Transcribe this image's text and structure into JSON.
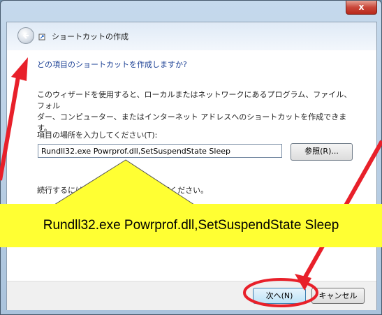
{
  "window": {
    "close_glyph": "x"
  },
  "nav": {
    "title": "ショートカットの作成",
    "back_icon": "back-arrow-icon",
    "wizard_icon": "shortcut-wizard-icon"
  },
  "content": {
    "heading": "どの項目のショートカットを作成しますか?",
    "description": "このウィザードを使用すると、ローカルまたはネットワークにあるプログラム、ファイル、フォル\nダー、コンピューター、またはインターネット アドレスへのショートカットを作成できます。",
    "location_label": "項目の場所を入力してください(T):",
    "location_value": "Rundll32.exe Powrprof.dll,SetSuspendState Sleep",
    "browse_label": "参照(R)...",
    "continue_left": "続行するには",
    "continue_right": "てください。"
  },
  "footer": {
    "next_label": "次へ(N)",
    "cancel_label": "キャンセル"
  },
  "callout": {
    "text": "Rundll32.exe Powrprof.dll,SetSuspendState Sleep",
    "color": "#ffff33"
  },
  "annotation": {
    "arrow_color": "#e8202a"
  }
}
